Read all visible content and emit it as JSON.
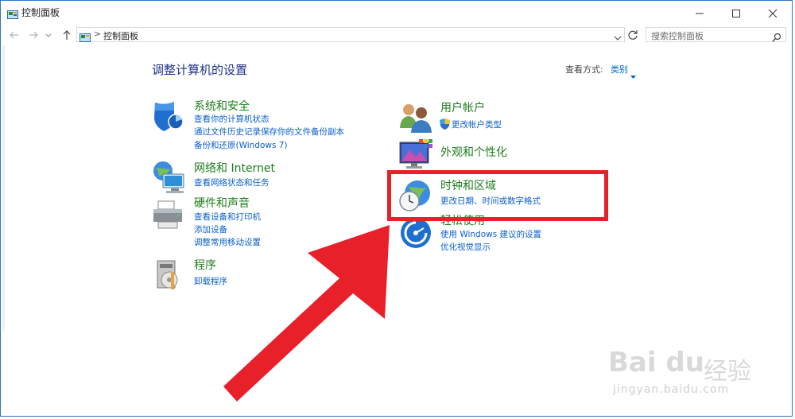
{
  "window": {
    "title": "控制面板"
  },
  "address": {
    "path": "控制面板",
    "separator": ">"
  },
  "search": {
    "placeholder": "搜索控制面板"
  },
  "main": {
    "heading": "调整计算机的设置",
    "view_by_label": "查看方式:",
    "view_by_value": "类别"
  },
  "categories": [
    {
      "title": "系统和安全",
      "icon": "shield-icon",
      "links": [
        "查看你的计算机状态",
        "通过文件历史记录保存你的文件备份副本",
        "备份和还原(Windows 7)"
      ]
    },
    {
      "title": "网络和 Internet",
      "icon": "network-icon",
      "links": [
        "查看网络状态和任务"
      ]
    },
    {
      "title": "硬件和声音",
      "icon": "printer-icon",
      "links": [
        "查看设备和打印机",
        "添加设备",
        "调整常用移动设置"
      ]
    },
    {
      "title": "程序",
      "icon": "programs-icon",
      "links": [
        "卸载程序"
      ]
    },
    {
      "title": "用户帐户",
      "icon": "users-icon",
      "links": [
        "更改帐户类型"
      ]
    },
    {
      "title": "外观和个性化",
      "icon": "monitor-icon",
      "links": []
    },
    {
      "title": "时钟和区域",
      "icon": "clock-globe-icon",
      "links": [
        "更改日期、时间或数字格式"
      ]
    },
    {
      "title": "轻松使用",
      "icon": "ease-of-access-icon",
      "links": [
        "使用 Windows 建议的设置",
        "优化视觉显示"
      ]
    }
  ],
  "watermark": {
    "logo_text": "Bai du",
    "brand": "经验",
    "url": "jingyan.baidu.com"
  },
  "colors": {
    "accent": "#0b5fcc",
    "category": "#1d7d1d",
    "heading": "#1e3287",
    "annotation": "#e8202a"
  }
}
